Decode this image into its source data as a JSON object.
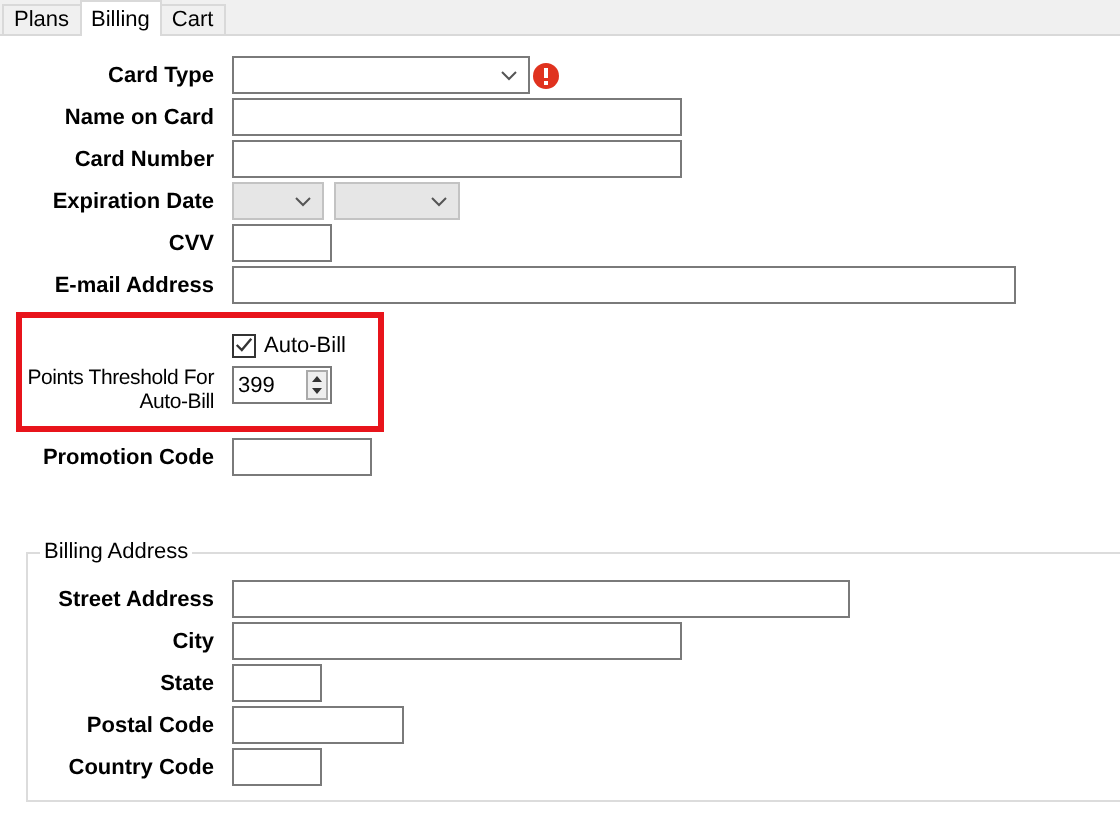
{
  "tabs": [
    {
      "label": "Plans",
      "selected": false
    },
    {
      "label": "Billing",
      "selected": true
    },
    {
      "label": "Cart",
      "selected": false
    }
  ],
  "sections": [
    {
      "highlighted": false,
      "fields": [
        {
          "kind": "dropdown",
          "label": "Card Type",
          "error": true,
          "disabled": false
        },
        {
          "kind": "text",
          "label": "Name on Card"
        },
        {
          "kind": "text",
          "label": "Card Number"
        },
        {
          "kind": "dual_dropdown",
          "label": "Expiration Date",
          "disabled": true
        },
        {
          "kind": "text",
          "label": "CVV"
        },
        {
          "kind": "text",
          "label": "E-mail Address"
        }
      ]
    },
    {
      "highlighted": true,
      "fields": [
        {
          "kind": "checkbox",
          "label": "Auto-Bill",
          "checked": true
        },
        {
          "kind": "spinner",
          "label": "Points Threshold For Auto-Bill",
          "value": "399"
        }
      ]
    },
    {
      "highlighted": false,
      "fields": [
        {
          "kind": "text",
          "label": "Promotion Code"
        }
      ]
    }
  ],
  "billing_address": {
    "title": "Billing Address",
    "fields": [
      {
        "kind": "text",
        "label": "Street Address"
      },
      {
        "kind": "text",
        "label": "City"
      },
      {
        "kind": "text",
        "label": "State"
      },
      {
        "kind": "text",
        "label": "Postal Code"
      },
      {
        "kind": "text",
        "label": "Country Code"
      }
    ]
  }
}
